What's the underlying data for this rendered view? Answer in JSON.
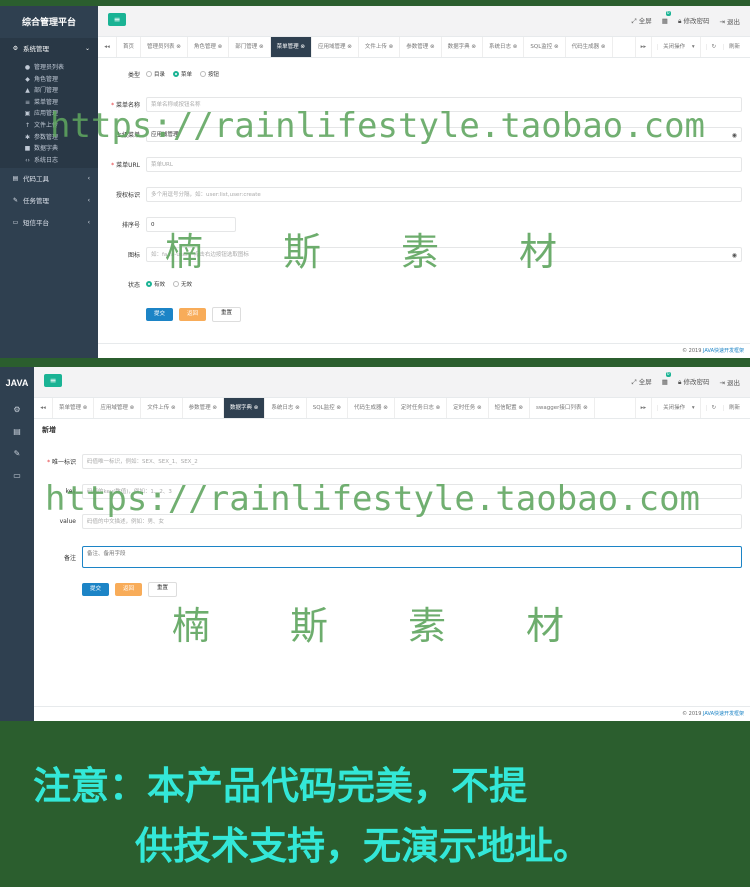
{
  "shot1": {
    "app_title": "综合管理平台",
    "sidebar": {
      "groups": [
        {
          "label": "系统管理",
          "icon": "gear-icon"
        },
        {
          "label": "代码工具",
          "icon": "code-icon"
        },
        {
          "label": "任务管理",
          "icon": "task-icon"
        },
        {
          "label": "短信平台",
          "icon": "monitor-icon"
        }
      ],
      "items": [
        {
          "label": "管理员列表",
          "icon": "user-icon"
        },
        {
          "label": "角色管理",
          "icon": "role-icon"
        },
        {
          "label": "部门管理",
          "icon": "department-icon"
        },
        {
          "label": "菜单管理",
          "icon": "menu-icon"
        },
        {
          "label": "应用管理",
          "icon": "app-icon"
        },
        {
          "label": "文件上传",
          "icon": "upload-icon"
        },
        {
          "label": "参数管理",
          "icon": "settings-icon"
        },
        {
          "label": "数据字典",
          "icon": "book-icon"
        },
        {
          "label": "系统日志",
          "icon": "log-icon"
        }
      ]
    },
    "topbar": {
      "fullscreen": "全屏",
      "badge": "0",
      "change_password": "修改密码",
      "logout": "退出"
    },
    "tabs": [
      "首页",
      "管理员列表",
      "角色管理",
      "部门管理",
      "菜单管理",
      "应用域管理",
      "文件上传",
      "参数管理",
      "数据字典",
      "系统日志",
      "SQL监控",
      "代码生成器"
    ],
    "active_tab": "菜单管理",
    "tab_tools": {
      "close": "关闭操作",
      "refresh": "刷新"
    },
    "form": {
      "type_label": "类型",
      "type_options": [
        "目录",
        "菜单",
        "按钮"
      ],
      "type_selected": "菜单",
      "name_label": "菜单名称",
      "name_placeholder": "菜单名称或按钮名称",
      "parent_label": "上级菜单",
      "parent_value": "应用域管理",
      "url_label": "菜单URL",
      "url_placeholder": "菜单URL",
      "perm_label": "授权标识",
      "perm_placeholder": "多个用逗号分隔，如：user:list,user:create",
      "order_label": "排序号",
      "order_value": "0",
      "icon_label": "图标",
      "icon_placeholder": "如：fa fa-user，点击右边按钮选取图标",
      "status_label": "状态",
      "status_options": [
        "有效",
        "无效"
      ],
      "status_selected": "有效",
      "buttons": {
        "submit": "提交",
        "back": "返回",
        "reset": "重置"
      }
    },
    "footer": {
      "year": "© 2019",
      "link": "JAVA快速开发框架"
    }
  },
  "shot2": {
    "app_title": "JAVA",
    "topbar": {
      "fullscreen": "全屏",
      "badge": "0",
      "change_password": "修改密码",
      "logout": "退出"
    },
    "tabs": [
      "菜单管理",
      "应用域管理",
      "文件上传",
      "参数管理",
      "数据字典",
      "系统日志",
      "SQL监控",
      "代码生成器",
      "定时任务日志",
      "定时任务",
      "短信配置",
      "swagger接口列表"
    ],
    "active_tab": "数据字典",
    "tab_tools": {
      "close": "关闭操作",
      "refresh": "刷新"
    },
    "section_title": "新增",
    "form": {
      "code_label": "唯一标识",
      "code_placeholder": "码值唯一标识，例如：SEX、SEX_1、SEX_2",
      "key_label": "key",
      "key_placeholder": "码值的key(数值)，例如：1、2、3",
      "value_label": "value",
      "value_placeholder": "码值的中文描述，例如：男、女",
      "remark_label": "备注",
      "remark_placeholder": "备注、备用字段",
      "buttons": {
        "submit": "提交",
        "back": "返回",
        "reset": "重置"
      }
    },
    "footer": {
      "year": "© 2019",
      "link": "JAVA快速开发框架"
    }
  },
  "watermark": {
    "url": "https://rainlifestyle.taobao.com",
    "chars": "楠斯素材"
  },
  "notice": {
    "line1": "注意：本产品代码完美，不提",
    "line2": "供技术支持，无演示地址。"
  }
}
